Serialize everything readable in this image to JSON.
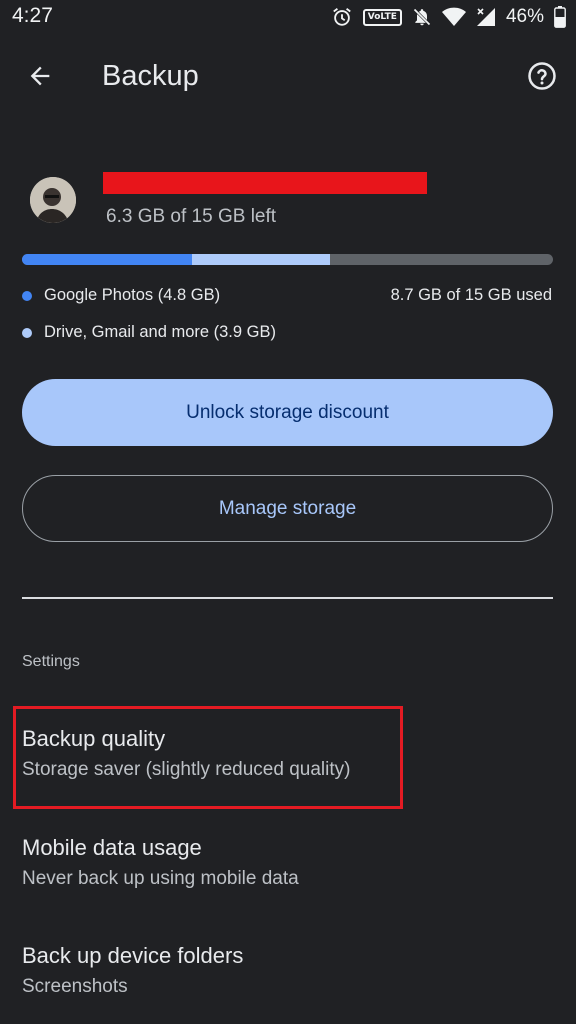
{
  "status_bar": {
    "time": "4:27",
    "volte": "VoLTE",
    "battery": "46%",
    "icons": [
      "alarm-icon",
      "volte-icon",
      "notifications-off-icon",
      "wifi-icon",
      "signal-icon",
      "battery-icon"
    ]
  },
  "app_bar": {
    "title": "Backup",
    "back_icon": "arrow-back-icon",
    "help_icon": "help-icon"
  },
  "account": {
    "storage_left": "6.3 GB of 15 GB left"
  },
  "storage": {
    "photos_fraction": 0.32,
    "drive_fraction": 0.26,
    "legend": [
      {
        "label": "Google Photos (4.8 GB)",
        "color": "#4285f4"
      },
      {
        "label": "Drive, Gmail and more (3.9 GB)",
        "color": "#aecbfa"
      }
    ],
    "used": "8.7 GB of 15 GB used"
  },
  "buttons": {
    "unlock": "Unlock storage discount",
    "manage": "Manage storage"
  },
  "settings": {
    "header": "Settings",
    "items": [
      {
        "title": "Backup quality",
        "subtitle": "Storage saver (slightly reduced quality)"
      },
      {
        "title": "Mobile data usage",
        "subtitle": "Never back up using mobile data"
      },
      {
        "title": "Back up device folders",
        "subtitle": "Screenshots"
      }
    ]
  },
  "colors": {
    "background": "#202124",
    "accent": "#a8c7fa",
    "highlight": "#e31b23",
    "redaction": "#e8151b"
  }
}
